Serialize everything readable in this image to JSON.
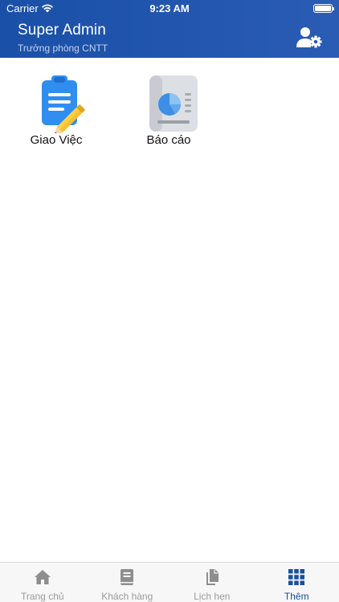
{
  "status_bar": {
    "carrier": "Carrier",
    "time": "9:23 AM"
  },
  "header": {
    "title": "Super Admin",
    "subtitle": "Trưởng phòng CNTT",
    "background_color": "#2356b0",
    "action_icon": "user-settings-icon"
  },
  "menu": [
    {
      "label": "Giao Việc",
      "icon": "task-assignment-icon"
    },
    {
      "label": "Báo cáo",
      "icon": "report-icon"
    }
  ],
  "tab_bar": {
    "active_color": "#1a4fa0",
    "inactive_color": "#9a9a9a",
    "items": [
      {
        "label": "Trang chủ",
        "icon": "home-icon",
        "active": false
      },
      {
        "label": "Khách hàng",
        "icon": "book-icon",
        "active": false
      },
      {
        "label": "Lịch hẹn",
        "icon": "documents-icon",
        "active": false
      },
      {
        "label": "Thêm",
        "icon": "grid-icon",
        "active": true
      }
    ]
  }
}
